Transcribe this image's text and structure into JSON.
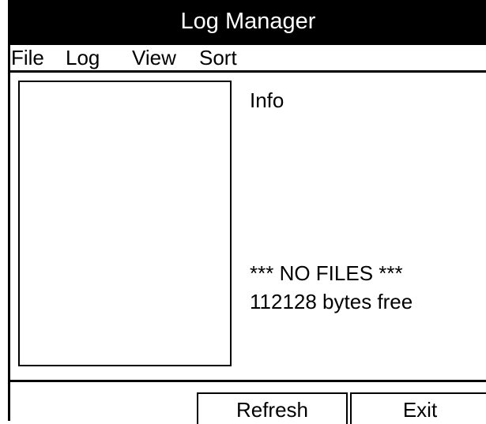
{
  "window": {
    "title": "Log Manager"
  },
  "menu": {
    "items": [
      {
        "label": "File"
      },
      {
        "label": "Log"
      },
      {
        "label": "View"
      },
      {
        "label": "Sort"
      }
    ]
  },
  "panel": {
    "info_label": "Info",
    "status_line_1": "*** NO FILES ***",
    "status_line_2": "112128 bytes free"
  },
  "buttons": {
    "refresh": "Refresh",
    "exit": "Exit"
  },
  "colors": {
    "titlebar_bg": "#000000",
    "titlebar_text": "#ffffff",
    "background": "#ffffff"
  }
}
